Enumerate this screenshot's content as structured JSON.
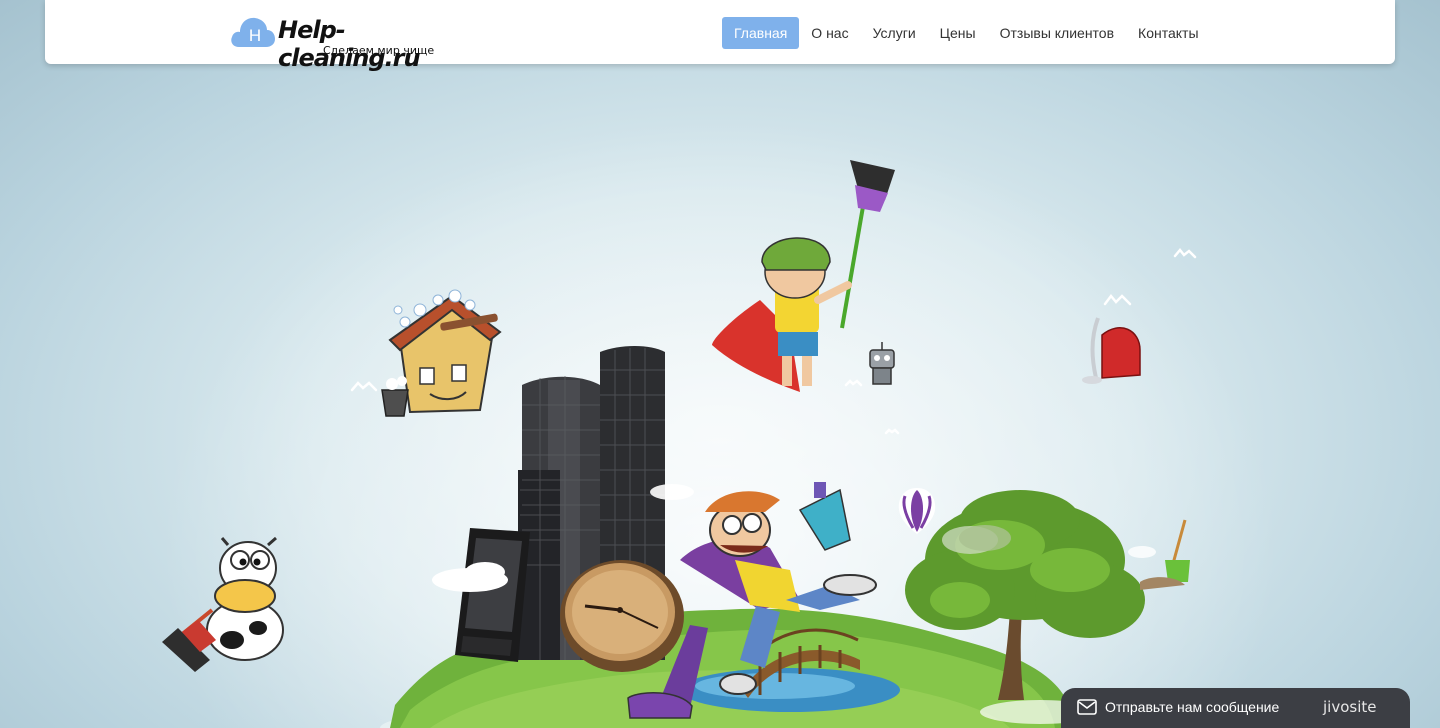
{
  "header": {
    "logo": {
      "letter": "H",
      "title": "Help-cleaning.ru",
      "tagline": "Сделаем мир чище"
    },
    "nav": [
      {
        "label": "Главная",
        "active": true
      },
      {
        "label": "О нас",
        "active": false
      },
      {
        "label": "Услуги",
        "active": false
      },
      {
        "label": "Цены",
        "active": false
      },
      {
        "label": "Отзывы клиентов",
        "active": false
      },
      {
        "label": "Контакты",
        "active": false
      }
    ]
  },
  "chat_widget": {
    "label": "Отправьте нам сообщение",
    "brand": "jivosite",
    "icon": "envelope-icon"
  },
  "colors": {
    "nav_active": "#7fb1eb",
    "logo_cloud": "#7fb1eb",
    "chat_bg": "#3c3e44"
  }
}
